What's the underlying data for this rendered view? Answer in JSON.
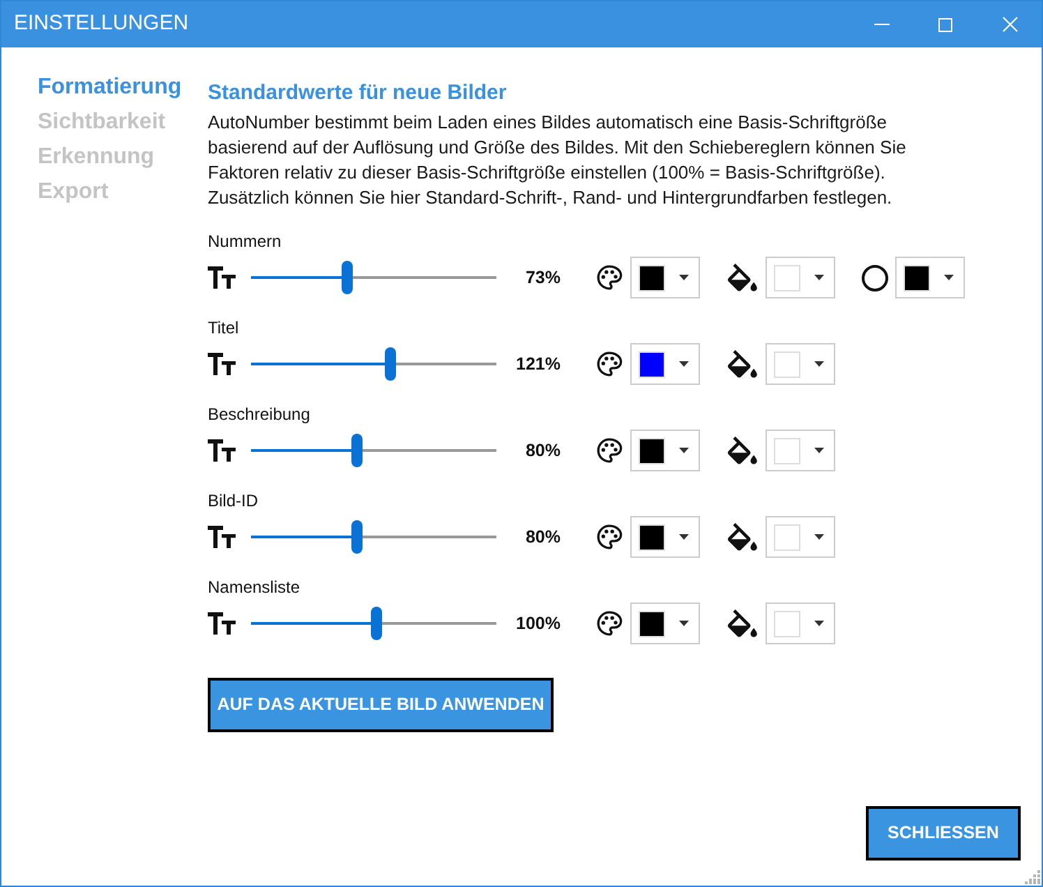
{
  "window": {
    "title": "EINSTELLUNGEN"
  },
  "sidebar": {
    "items": [
      {
        "label": "Formatierung",
        "selected": true
      },
      {
        "label": "Sichtbarkeit",
        "selected": false
      },
      {
        "label": "Erkennung",
        "selected": false
      },
      {
        "label": "Export",
        "selected": false
      }
    ]
  },
  "section": {
    "heading": "Standardwerte für neue Bilder",
    "description_lines": [
      "AutoNumber bestimmt beim Laden eines Bildes automatisch eine Basis-Schriftgröße",
      "basierend auf der Auflösung und Größe des Bildes. Mit den Schiebereglern können Sie",
      "Faktoren relativ zu dieser Basis-Schriftgröße einstellen (100% = Basis-Schriftgröße).",
      "Zusätzlich können Sie hier Standard-Schrift-, Rand- und Hintergrundfarben festlegen."
    ]
  },
  "rows": [
    {
      "label": "Nummern",
      "level": 0.39,
      "reading": "73%",
      "swatches": [
        {
          "kind": "font",
          "color": "#000000"
        },
        {
          "kind": "fill",
          "color": "#ffffff"
        },
        {
          "kind": "border",
          "color": "#000000"
        }
      ]
    },
    {
      "label": "Titel",
      "level": 0.57,
      "reading": "121%",
      "swatches": [
        {
          "kind": "font",
          "color": "#0000ff"
        },
        {
          "kind": "fill",
          "color": "#ffffff"
        }
      ]
    },
    {
      "label": "Beschreibung",
      "level": 0.43,
      "reading": "80%",
      "swatches": [
        {
          "kind": "font",
          "color": "#000000"
        },
        {
          "kind": "fill",
          "color": "#ffffff"
        }
      ]
    },
    {
      "label": "Bild-ID",
      "level": 0.43,
      "reading": "80%",
      "swatches": [
        {
          "kind": "font",
          "color": "#000000"
        },
        {
          "kind": "fill",
          "color": "#ffffff"
        }
      ]
    },
    {
      "label": "Namensliste",
      "level": 0.51,
      "reading": "100%",
      "swatches": [
        {
          "kind": "font",
          "color": "#000000"
        },
        {
          "kind": "fill",
          "color": "#ffffff"
        }
      ]
    }
  ],
  "buttons": {
    "apply": "AUF DAS AKTUELLE BILD ANWENDEN",
    "close": "SCHLIESSEN"
  }
}
